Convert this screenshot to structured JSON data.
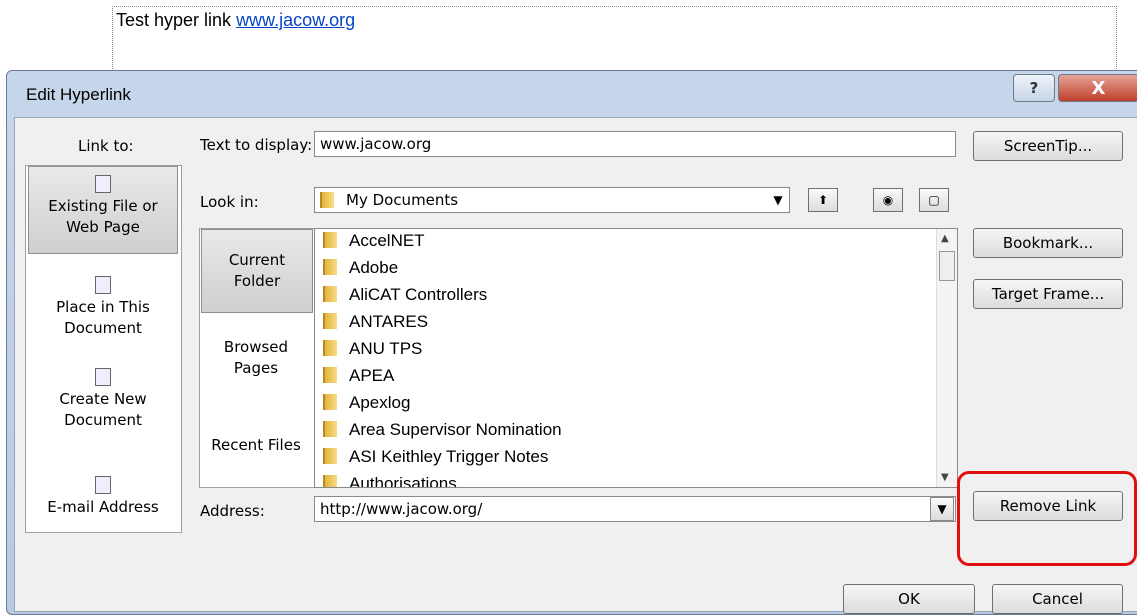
{
  "document": {
    "text": "Test hyper  link ",
    "link": "www.jacow.org"
  },
  "dialog": {
    "title": "Edit Hyperlink",
    "help_label": "?",
    "close_label": "X"
  },
  "link_to": {
    "label": "Link to:",
    "items": [
      {
        "line1": "Existing File or",
        "line2": "Web Page",
        "icon": "file-web-icon"
      },
      {
        "line1": "Place in This",
        "line2": "Document",
        "icon": "place-doc-icon"
      },
      {
        "line1": "Create New",
        "line2": "Document",
        "icon": "new-doc-icon"
      },
      {
        "line1": "E-mail Address",
        "line2": "",
        "icon": "email-icon"
      }
    ]
  },
  "text_to_display": {
    "label": "Text to display:",
    "value": "www.jacow.org"
  },
  "look_in": {
    "label": "Look in:",
    "value": "My Documents"
  },
  "tabs": [
    {
      "line1": "Current",
      "line2": "Folder"
    },
    {
      "line1": "Browsed",
      "line2": "Pages"
    },
    {
      "line1": "Recent Files",
      "line2": ""
    }
  ],
  "files": [
    "AccelNET",
    "Adobe",
    "AliCAT Controllers",
    "ANTARES",
    "ANU TPS",
    "APEA",
    "Apexlog",
    "Area Supervisor Nomination",
    "ASI Keithley Trigger Notes",
    "Authorisations"
  ],
  "address": {
    "label": "Address:",
    "value": "http://www.jacow.org/"
  },
  "buttons": {
    "screentip": "ScreenTip...",
    "bookmark": "Bookmark...",
    "target_frame": "Target Frame...",
    "remove_link": "Remove Link",
    "ok": "OK",
    "cancel": "Cancel"
  },
  "colors": {
    "highlight": "#e01010",
    "link": "#0645c8"
  }
}
